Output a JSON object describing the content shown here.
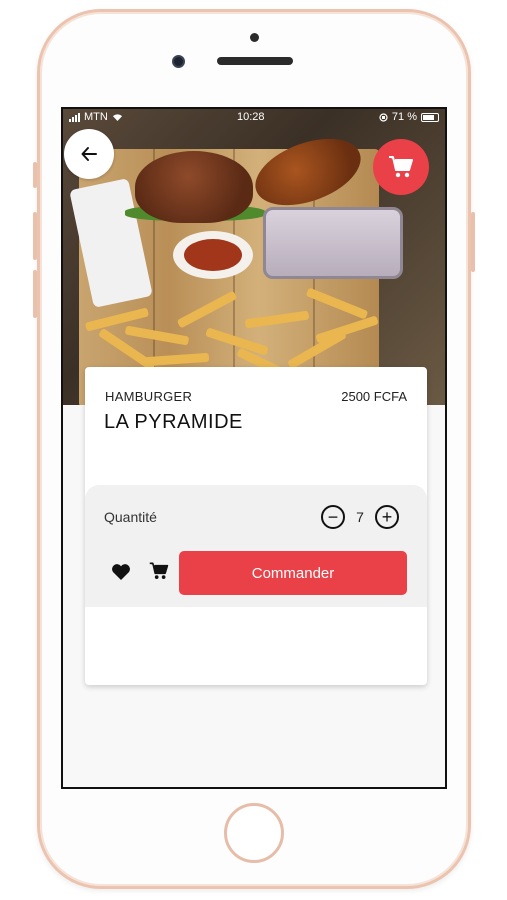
{
  "status_bar": {
    "carrier": "MTN",
    "time": "10:28",
    "battery": "71 %"
  },
  "product": {
    "category": "HAMBURGER",
    "price": "2500 FCFA",
    "name": "LA PYRAMIDE"
  },
  "quantity": {
    "label": "Quantité",
    "value": "7",
    "decrement_symbol": "−",
    "increment_symbol": "+"
  },
  "actions": {
    "order_label": "Commander"
  },
  "icons": {
    "back": "arrow-left-icon",
    "cart": "cart-icon",
    "favorite": "heart-icon",
    "add_to_cart": "cart-icon"
  },
  "colors": {
    "accent": "#ea4148",
    "card": "#ffffff",
    "panel": "#f1f1f1"
  }
}
